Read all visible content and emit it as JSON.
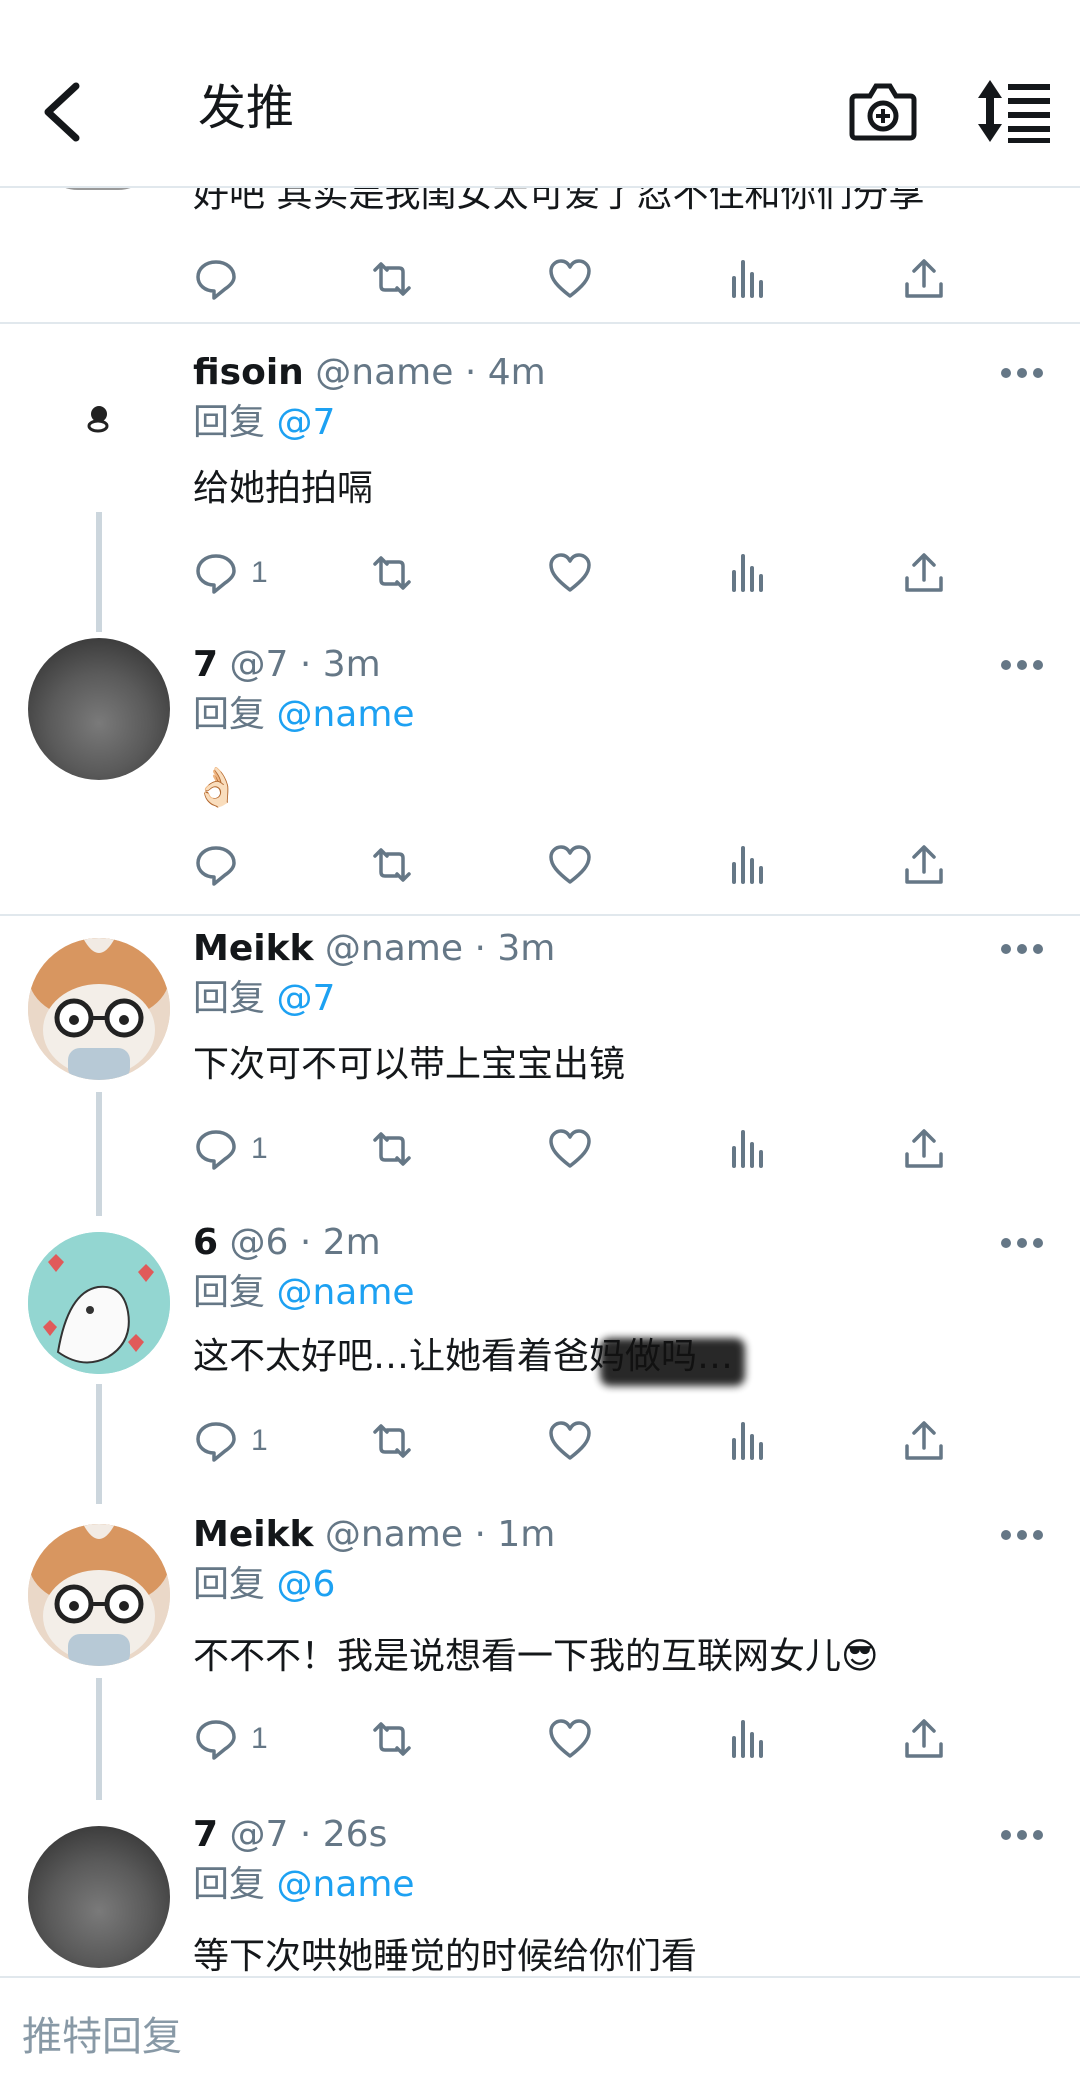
{
  "header": {
    "title": "发推",
    "back_icon": "back-arrow-icon",
    "camera_icon": "camera-add-icon",
    "sort_icon": "sort-icon"
  },
  "top_tweet": {
    "text": "好吧 其实是我闺女太可爱了忍不住和你们分享"
  },
  "tweets": [
    {
      "name": "fisoin",
      "handle": "@name",
      "time": "4m",
      "reply_label": "回复",
      "reply_to": "@7",
      "text": "给她拍拍嗝",
      "replies": "1"
    },
    {
      "name": "7",
      "handle": "@7",
      "time": "3m",
      "reply_label": "回复",
      "reply_to": "@name",
      "text": "👌🏻",
      "replies": ""
    },
    {
      "name": "Meikk",
      "handle": "@name",
      "time": "3m",
      "reply_label": "回复",
      "reply_to": "@7",
      "text": "下次可不可以带上宝宝出镜",
      "replies": "1"
    },
    {
      "name": "6",
      "handle": "@6",
      "time": "2m",
      "reply_label": "回复",
      "reply_to": "@name",
      "text": "这不太好吧…让她看着爸妈做吗…",
      "replies": "1"
    },
    {
      "name": "Meikk",
      "handle": "@name",
      "time": "1m",
      "reply_label": "回复",
      "reply_to": "@6",
      "text": "不不不！我是说想看一下我的互联网女儿😎",
      "replies": "1"
    },
    {
      "name": "7",
      "handle": "@7",
      "time": "26s",
      "reply_label": "回复",
      "reply_to": "@name",
      "text": "等下次哄她睡觉的时候给你们看"
    }
  ],
  "composer": {
    "placeholder": "推特回复"
  },
  "colors": {
    "link": "#1da1f2",
    "secondary": "#657786",
    "border": "#e1e8ed",
    "thread": "#ccd6dd"
  }
}
